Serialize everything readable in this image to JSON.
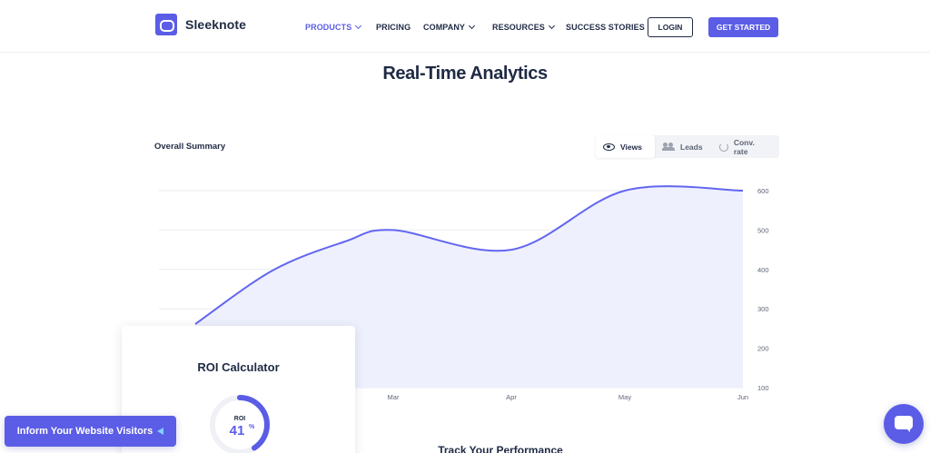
{
  "brand": {
    "name": "Sleeknote",
    "accent": "#5b5de6",
    "dark": "#1f2a44"
  },
  "nav": {
    "items": [
      {
        "label": "PRODUCTS",
        "active": true,
        "dropdown": true
      },
      {
        "label": "PRICING",
        "active": false,
        "dropdown": false
      },
      {
        "label": "COMPANY",
        "active": false,
        "dropdown": true
      },
      {
        "label": "RESOURCES",
        "active": false,
        "dropdown": true
      },
      {
        "label": "SUCCESS STORIES",
        "active": false,
        "dropdown": false
      }
    ],
    "login_label": "LOGIN",
    "cta_label": "GET STARTED"
  },
  "section": {
    "title": "Real-Time Analytics"
  },
  "summary": {
    "label": "Overall Summary",
    "toggles": [
      {
        "label": "Views",
        "icon": "eye-icon",
        "active": true
      },
      {
        "label": "Leads",
        "icon": "users-icon",
        "active": false
      },
      {
        "label": "Conv. rate",
        "icon": "refresh-icon",
        "active": false
      }
    ]
  },
  "chart_data": {
    "type": "area",
    "x": [
      "Mar",
      "Apr",
      "May",
      "Jun"
    ],
    "visible_x_labels": [
      "Mar",
      "Apr",
      "May",
      "Jun"
    ],
    "series": [
      {
        "values": [
          500,
          450,
          600,
          600
        ]
      }
    ],
    "ylim": [
      100,
      600
    ],
    "y_ticks": [
      100,
      200,
      300,
      400,
      500,
      600
    ],
    "y_axis_side": "right",
    "grid": true,
    "line_color": "#6366f1",
    "fill_color": "#eef0fd"
  },
  "roi": {
    "title": "ROI Calculator",
    "label": "ROI",
    "value": "41",
    "unit": "%",
    "progress": 0.41
  },
  "track": {
    "title": "Track Your Performance"
  },
  "widgets": {
    "inform_label": "Inform Your Website Visitors",
    "chat_icon": "chat-icon"
  }
}
